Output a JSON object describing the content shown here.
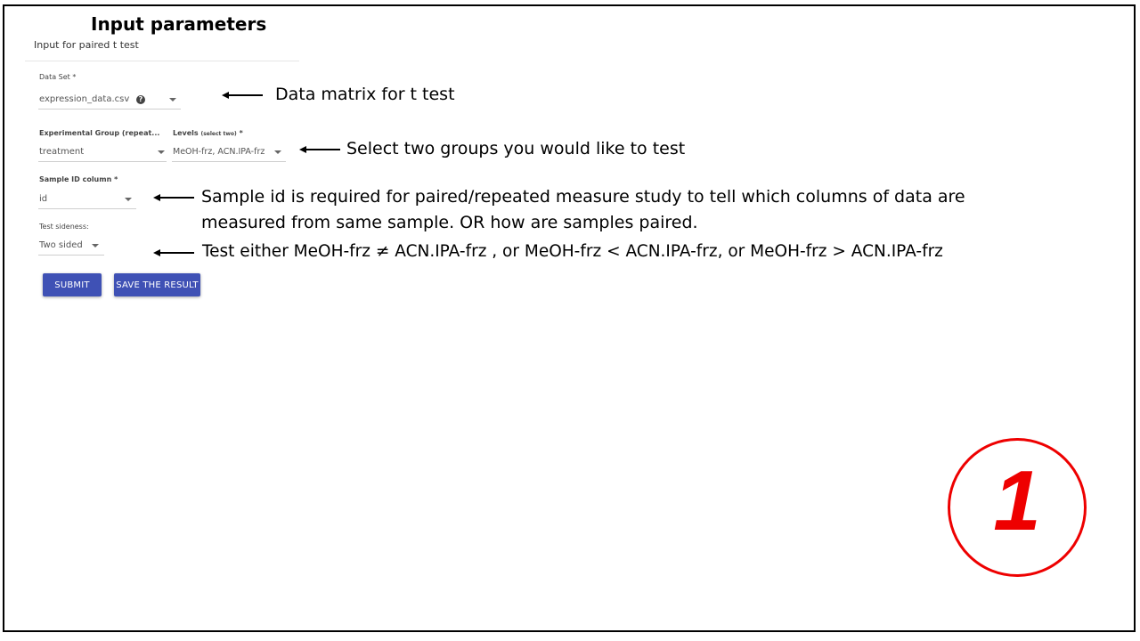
{
  "panel": {
    "title": "Input parameters",
    "subtitle": "Input for paired t test"
  },
  "fields": {
    "dataset": {
      "label": "Data Set *",
      "value": "expression_data.csv",
      "help_icon": "question-circle-icon"
    },
    "group": {
      "label": "Experimental Group (repeat...",
      "value": "treatment"
    },
    "levels": {
      "label": "Levels",
      "label_note": "(select two)",
      "label_req": " *",
      "value": "MeOH-frz, ACN.IPA-frz"
    },
    "sample_id": {
      "label": "Sample ID column *",
      "value": "id"
    },
    "sideness": {
      "label": "Test sideness:",
      "value": "Two sided"
    }
  },
  "buttons": {
    "submit": "SUBMIT",
    "save": "SAVE THE RESULT"
  },
  "annotations": {
    "data_matrix": "Data matrix for t test",
    "select_groups": "Select two groups you would like to test",
    "sample_id_line1": "Sample id is required for paired/repeated measure study to tell which columns of data are",
    "sample_id_line2": "measured from same sample. OR how are samples paired.",
    "test_direction": "Test either MeOH-frz ≠ ACN.IPA-frz , or MeOH-frz < ACN.IPA-frz, or MeOH-frz > ACN.IPA-frz"
  },
  "badge": {
    "number": "1"
  },
  "colors": {
    "primary_button": "#3f51b5",
    "badge": "#ee0000"
  }
}
